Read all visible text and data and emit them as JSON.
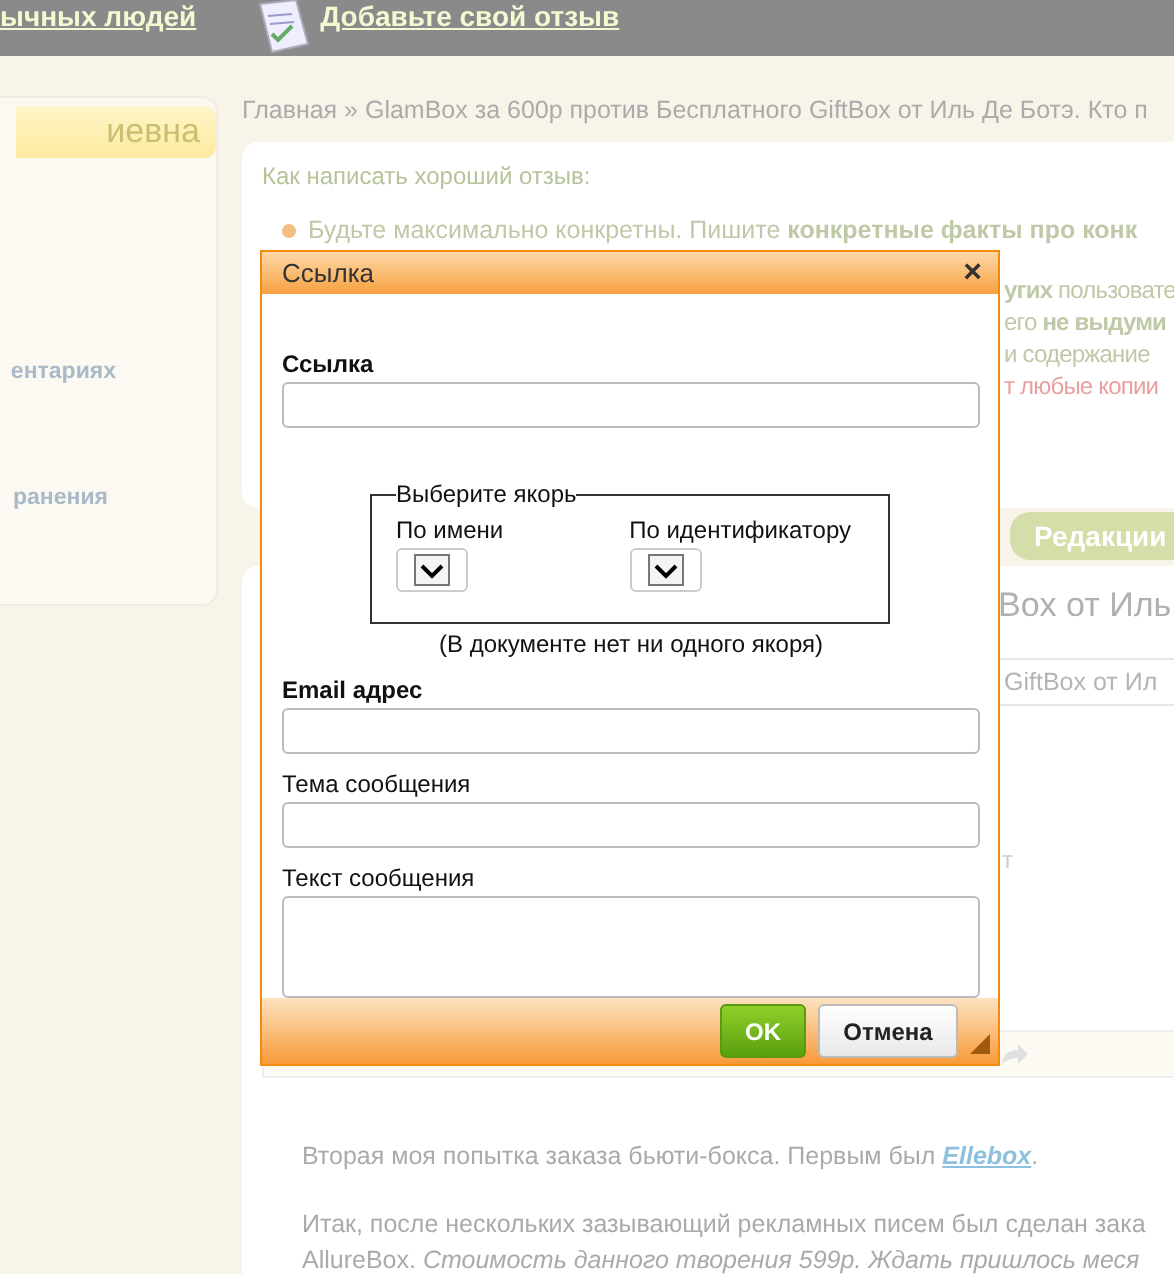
{
  "header": {
    "links": [
      {
        "label": "ычных людей"
      },
      {
        "label": "Добавьте свой отзыв"
      }
    ]
  },
  "sidebar": {
    "title": "иевна",
    "items": [
      "ентариях",
      "ранения"
    ]
  },
  "breadcrumb": "Главная » GlamBox за 600р против Бесплатного GiftBox от Иль Де Ботэ. Кто п",
  "tips": {
    "title": "Как написать хороший отзыв:",
    "lines": [
      {
        "kind": "bullet",
        "text": "Будьте максимально конкретны. Пишите **конкретные факты про конк**"
      },
      {
        "kind": "partial",
        "text": "**угих** пользовате"
      },
      {
        "kind": "partial",
        "text": "его **не выдуми**"
      },
      {
        "kind": "partial",
        "text": "и содержание"
      },
      {
        "kind": "warning",
        "text": "т любые копии"
      }
    ]
  },
  "edit_tab": "Редакции",
  "editor": {
    "title": "Box от Иль",
    "title_field": "GiftBox от Ил",
    "fragment": "т",
    "paragraphs": [
      "Вторая моя попытка заказа бьюти-бокса. Первым был **Ellebox**.",
      "Итак, после нескольких зазывающий рекламных писем был сделан зака",
      "AllureBox. *Стоимость данного творения 599р. Ждать пришлось меся*"
    ]
  },
  "dialog": {
    "title": "Ссылка",
    "close": "×",
    "link_label": "Ссылка",
    "anchor_group": {
      "legend": "Выберите якорь",
      "selects": [
        {
          "label": "По имени"
        },
        {
          "label": "По идентификатору"
        }
      ],
      "note": "(В документе нет ни одного якоря)"
    },
    "fields": [
      {
        "label": "Email адрес",
        "bold": true,
        "kind": "input"
      },
      {
        "label": "Тема сообщения",
        "bold": false,
        "kind": "input"
      },
      {
        "label": "Текст сообщения",
        "bold": false,
        "kind": "textarea"
      }
    ],
    "buttons": [
      {
        "label": "OK",
        "kind": "primary"
      },
      {
        "label": "Отмена",
        "kind": "secondary"
      }
    ]
  }
}
